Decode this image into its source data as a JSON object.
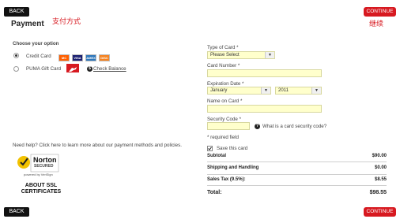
{
  "header": {
    "back_label": "BACK",
    "continue_label": "CONTINUE",
    "payment_method_note": "支付方式",
    "continue_note": "继续",
    "page_title": "Payment"
  },
  "options": {
    "heading": "Choose your option",
    "credit_card_label": "Credit Card",
    "gift_card_label": "PUMA Gift Card",
    "check_balance_label": "Check Balance",
    "card_icons": [
      "mastercard-icon",
      "visa-icon",
      "amex-icon",
      "discover-icon"
    ],
    "selected": "Credit Card"
  },
  "form": {
    "type_label": "Type of Card *",
    "type_value": "Please Select",
    "number_label": "Card Number *",
    "number_value": "",
    "exp_label": "Expiration Date *",
    "exp_month": "January",
    "exp_year": "2011",
    "name_label": "Name on Card *",
    "name_value": "",
    "security_label": "Security Code *",
    "security_value": "",
    "security_help": "What is a card security code?",
    "required_note": "* required field",
    "save_card_label": "Save this card",
    "save_card_checked": true
  },
  "totals": {
    "rows": [
      {
        "label": "Subtotal",
        "value": "$90.00"
      },
      {
        "label": "Shipping and Handling",
        "value": "$0.00"
      },
      {
        "label": "Sales Tax (9.5%):",
        "value": "$8.55"
      }
    ],
    "total_label": "Total:",
    "total_value": "$98.55"
  },
  "help": {
    "text": "Need help? Click here to learn more about our payment methods and policies."
  },
  "ssl": {
    "norton_name": "Norton",
    "norton_secured": "SECURED",
    "norton_powered": "powered by VeriSign",
    "about_label": "ABOUT SSL CERTIFICATES"
  },
  "colors": {
    "accent_red": "#d71920",
    "field_yellow": "#ffffcc",
    "back_black": "#111111"
  }
}
